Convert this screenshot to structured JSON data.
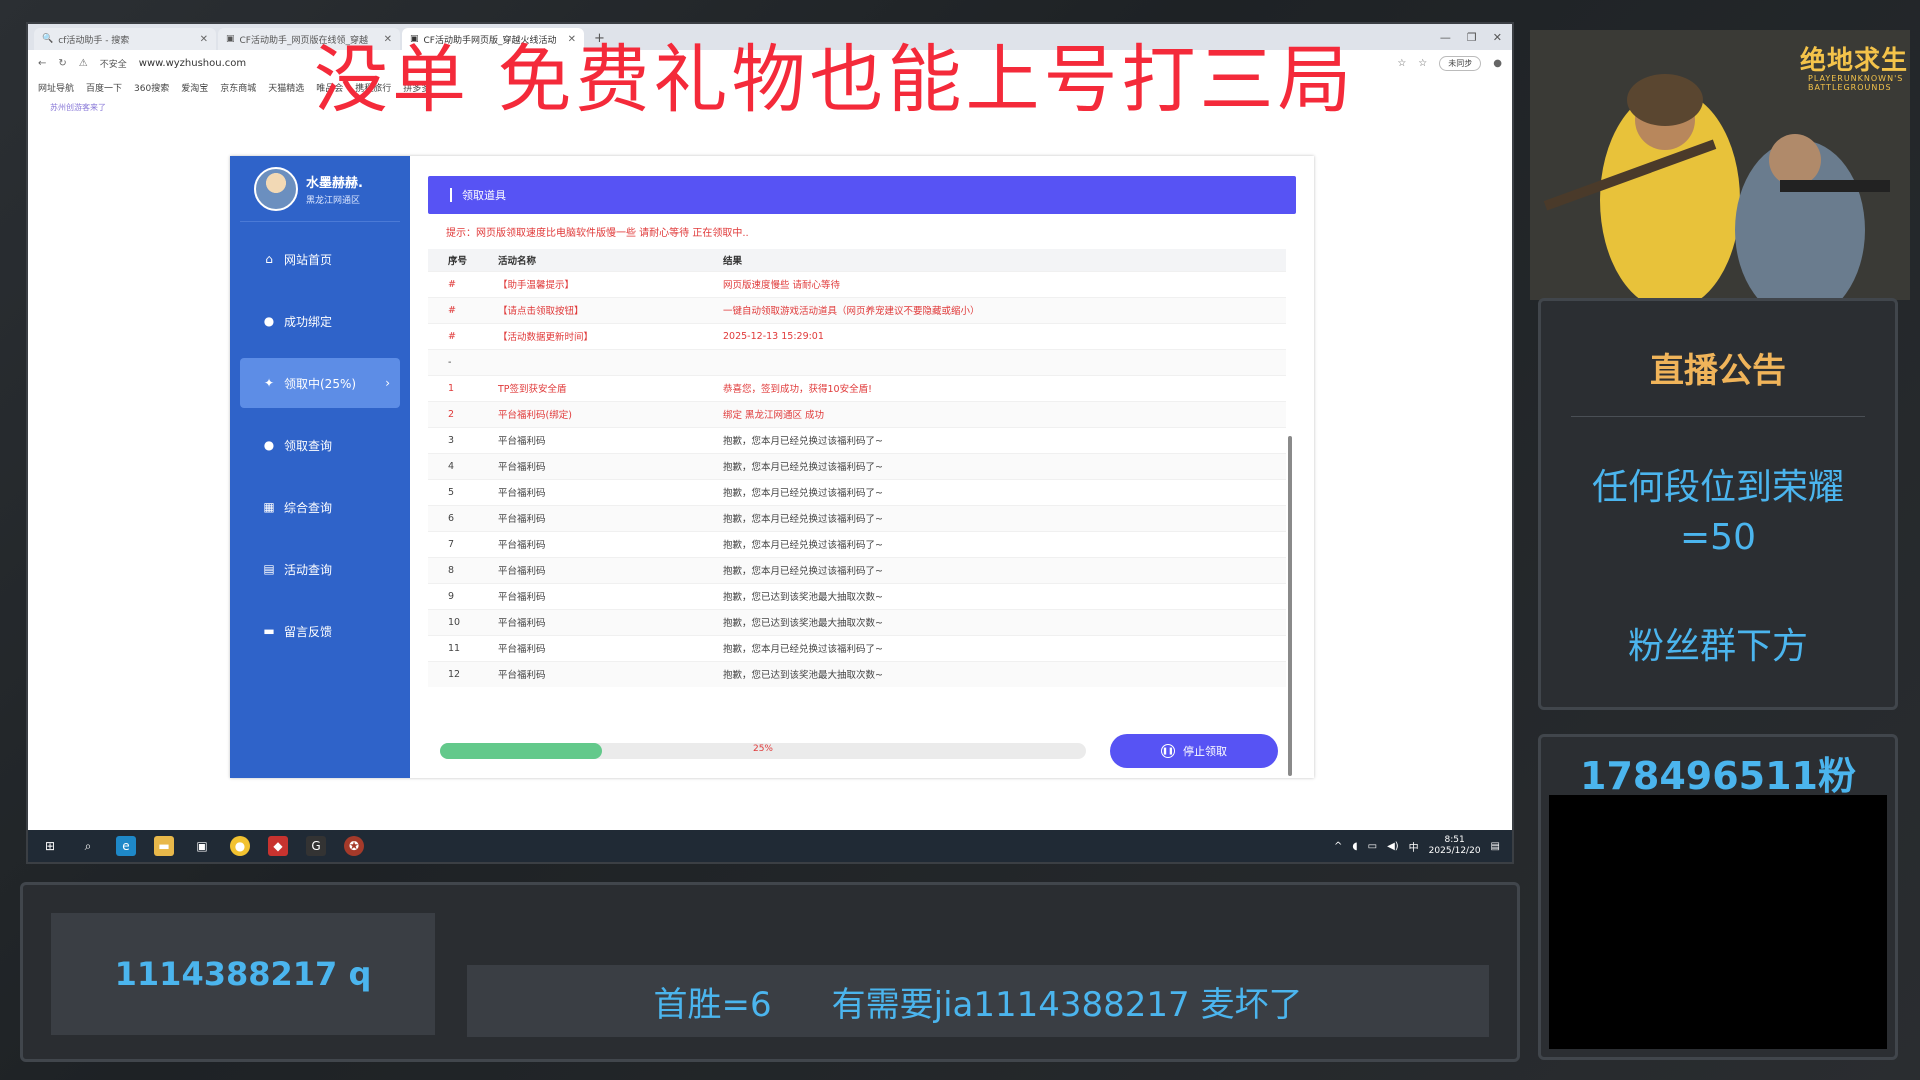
{
  "browser": {
    "tabs": [
      {
        "label": "cf活动助手 - 搜索",
        "active": false
      },
      {
        "label": "CF活动助手_网页版在线领_穿越",
        "active": false
      },
      {
        "label": "CF活动助手网页版_穿越火线活动",
        "active": true
      }
    ],
    "insecure_label": "不安全",
    "url": "www.wyzhushou.com",
    "sync_label": "未同步",
    "bookmarks": [
      "网址导航",
      "百度一下",
      "360搜索",
      "爱淘宝",
      "京东商城",
      "天猫精选",
      "唯品会",
      "携程旅行",
      "拼多多"
    ],
    "small_note": "苏州创游客来了"
  },
  "overlay_banner": "没单 免费礼物也能上号打三局",
  "app": {
    "user": {
      "name": "水墨赫赫.",
      "region": "黑龙江网通区"
    },
    "nav": [
      {
        "label": "网站首页",
        "icon": "home-icon",
        "active": false
      },
      {
        "label": "成功绑定",
        "icon": "user-icon",
        "active": false
      },
      {
        "label": "领取中(25%)",
        "icon": "gift-icon",
        "active": true
      },
      {
        "label": "领取查询",
        "icon": "search-user-icon",
        "active": false
      },
      {
        "label": "综合查询",
        "icon": "grid-icon",
        "active": false
      },
      {
        "label": "活动查询",
        "icon": "doc-icon",
        "active": false
      },
      {
        "label": "留言反馈",
        "icon": "message-icon",
        "active": false
      }
    ],
    "card_title": "领取道具",
    "tip": "提示：网页版领取速度比电脑软件版慢一些 请耐心等待 正在领取中..",
    "columns": [
      "序号",
      "活动名称",
      "结果"
    ],
    "rows": [
      {
        "no": "#",
        "name": "【助手温馨提示】",
        "result": "网页版速度慢些 请耐心等待",
        "red": true
      },
      {
        "no": "#",
        "name": "【请点击领取按钮】",
        "result": "一键自动领取游戏活动道具（网页养宠建议不要隐藏或缩小）",
        "red": true
      },
      {
        "no": "#",
        "name": "【活动数据更新时间】",
        "result": "2025-12-13 15:29:01",
        "red": true
      },
      {
        "no": "-",
        "name": "",
        "result": "",
        "red": false
      },
      {
        "no": "1",
        "name": "TP签到获安全盾",
        "result": "恭喜您，签到成功，获得10安全盾!",
        "red": true
      },
      {
        "no": "2",
        "name": "平台福利码(绑定)",
        "result": "绑定 黑龙江网通区 成功",
        "red": true
      },
      {
        "no": "3",
        "name": "平台福利码",
        "result": "抱歉，您本月已经兑换过该福利码了~",
        "red": false
      },
      {
        "no": "4",
        "name": "平台福利码",
        "result": "抱歉，您本月已经兑换过该福利码了~",
        "red": false
      },
      {
        "no": "5",
        "name": "平台福利码",
        "result": "抱歉，您本月已经兑换过该福利码了~",
        "red": false
      },
      {
        "no": "6",
        "name": "平台福利码",
        "result": "抱歉，您本月已经兑换过该福利码了~",
        "red": false
      },
      {
        "no": "7",
        "name": "平台福利码",
        "result": "抱歉，您本月已经兑换过该福利码了~",
        "red": false
      },
      {
        "no": "8",
        "name": "平台福利码",
        "result": "抱歉，您本月已经兑换过该福利码了~",
        "red": false
      },
      {
        "no": "9",
        "name": "平台福利码",
        "result": "抱歉，您已达到该奖池最大抽取次数~",
        "red": false
      },
      {
        "no": "10",
        "name": "平台福利码",
        "result": "抱歉，您已达到该奖池最大抽取次数~",
        "red": false
      },
      {
        "no": "11",
        "name": "平台福利码",
        "result": "抱歉，您本月已经兑换过该福利码了~",
        "red": false
      },
      {
        "no": "12",
        "name": "平台福利码",
        "result": "抱歉，您已达到该奖池最大抽取次数~",
        "red": false
      }
    ],
    "progress": {
      "percent": 25,
      "label": "25%"
    },
    "stop_button": "停止领取"
  },
  "taskbar": {
    "ime": "中",
    "time": "8:51",
    "date": "2025/12/20"
  },
  "stream": {
    "game_logo": "绝地求生",
    "game_sub": "PLAYERUNKNOWN'S BATTLEGROUNDS",
    "announcement_title": "直播公告",
    "announcement_line1": "任何段位到荣耀",
    "announcement_line2": "=50",
    "announcement_line3": "粉丝群下方",
    "fans_count": "178496511粉",
    "qq": "1114388217 q",
    "msg_part1": "首胜=6",
    "msg_part2": "有需要jia1114388217  麦坏了"
  },
  "colors": {
    "accent": "#5753f4",
    "sidebar": "#2f63c9",
    "banner_red": "#f42a3a",
    "stream_blue": "#4bb5ee",
    "stream_gold": "#f0b45a",
    "progress_green": "#63c98b"
  }
}
